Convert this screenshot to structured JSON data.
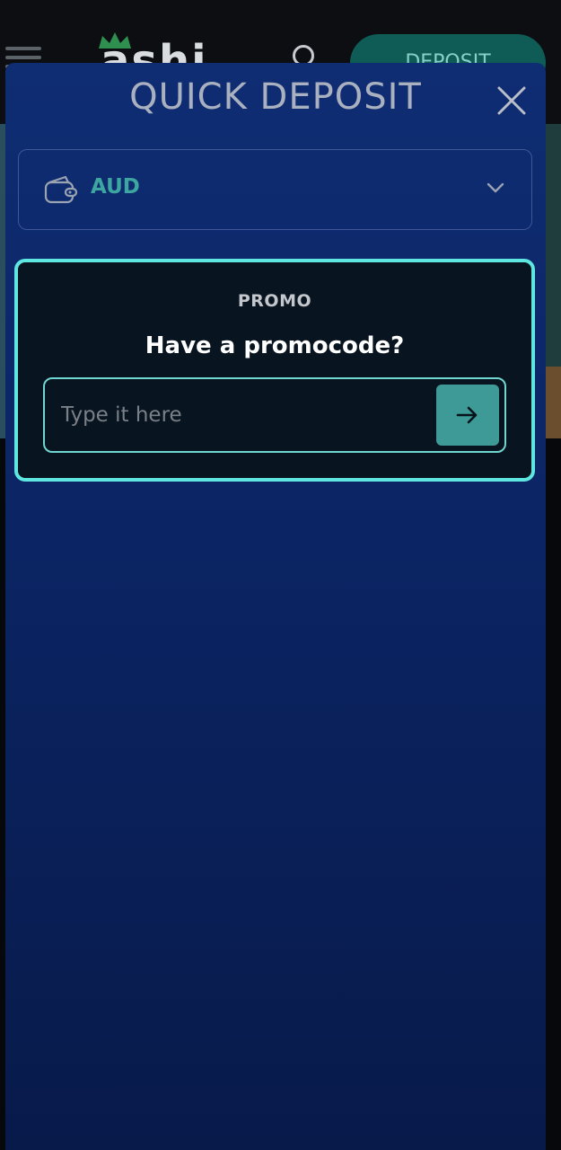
{
  "background": {
    "logo_text": "ashi",
    "deposit_label": "DEPOSIT"
  },
  "modal": {
    "title": "QUICK DEPOSIT",
    "close_icon": "close-icon",
    "currency": {
      "icon": "wallet-icon",
      "code": "AUD",
      "chevron": "chevron-down-icon"
    },
    "promo": {
      "label": "PROMO",
      "heading": "Have a promocode?",
      "input_placeholder": "Type it here",
      "input_value": "",
      "submit_icon": "arrow-right-icon"
    }
  },
  "colors": {
    "accent_teal": "#5ee6e0",
    "button_teal": "#3d9a97",
    "currency_text": "#3ea6a0",
    "modal_bg": "#0f2d73"
  }
}
